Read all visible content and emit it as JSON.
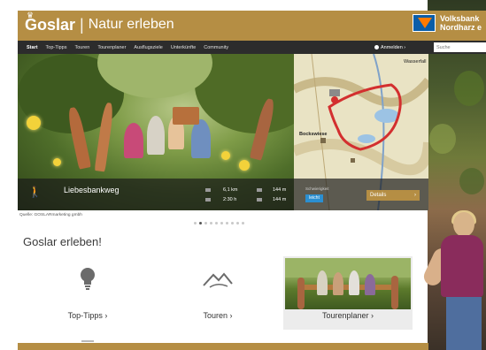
{
  "header": {
    "logo_name": "Goslar",
    "logo_separator": "|",
    "logo_tagline": "Natur erleben",
    "partner_line1": "Volksbank",
    "partner_line2": "Nordharz e"
  },
  "nav": {
    "items": [
      "Start",
      "Top-Tipps",
      "Touren",
      "Tourenplaner",
      "Ausflugsziele",
      "Unterkünfte",
      "Community"
    ],
    "login": "Anmelden ›",
    "search_placeholder": "Suche"
  },
  "hero": {
    "route_name": "Liebesbankweg",
    "distance": "6,1 km",
    "duration": "2:30 h",
    "ascent": "144 m",
    "descent": "144 m",
    "difficulty_label": "Schwierigkeit",
    "difficulty": "leicht",
    "details": "Details",
    "map_label_town": "Bockswiese",
    "map_label_area": "Wasserfall"
  },
  "credit": "Quelle: GOSLARmarketing gmbh",
  "slider": {
    "count": 10,
    "active_index": 1
  },
  "section": {
    "title": "Goslar erleben!",
    "tiles": [
      {
        "label": "Top-Tipps ›",
        "icon": "lightbulb-icon"
      },
      {
        "label": "Touren ›",
        "icon": "mountain-icon"
      },
      {
        "label": "Tourenplaner ›",
        "icon": "photo"
      }
    ]
  },
  "colors": {
    "brand_gold": "#b58e44",
    "nav_dark": "#2c2c2c",
    "route_red": "#d32f2f",
    "badge_blue": "#2b8fd1",
    "partner_blue": "#0a5da8"
  }
}
